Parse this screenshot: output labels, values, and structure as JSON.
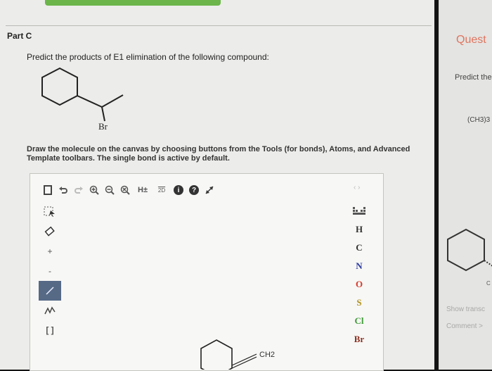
{
  "part": {
    "title": "Part C"
  },
  "question": {
    "text": "Predict the products of E1 elimination of the following compound:"
  },
  "compound": {
    "substituent_label": "Br"
  },
  "instructions": {
    "text": "Draw the molecule on the canvas by choosing buttons from the Tools (for bonds), Atoms, and Advanced Template toolbars. The single bond is active by default."
  },
  "editor": {
    "top_toolbar": [
      {
        "name": "new-document-icon",
        "glyph": "▢"
      },
      {
        "name": "undo-icon",
        "glyph": "↶"
      },
      {
        "name": "redo-icon",
        "glyph": "↷"
      },
      {
        "name": "zoom-in-icon",
        "glyph": "⊕"
      },
      {
        "name": "zoom-out-icon",
        "glyph": "⊖"
      },
      {
        "name": "reset-zoom-icon",
        "glyph": "⊗"
      },
      {
        "name": "explicit-hydrogens-button",
        "label": "H±"
      },
      {
        "name": "3d-view-button",
        "label": "2D"
      },
      {
        "name": "info-icon",
        "glyph": "i"
      },
      {
        "name": "help-icon",
        "glyph": "?"
      },
      {
        "name": "fullscreen-icon",
        "glyph": "⤢"
      }
    ],
    "atoms": [
      {
        "symbol": "H",
        "color": "#333333"
      },
      {
        "symbol": "C",
        "color": "#333333"
      },
      {
        "symbol": "N",
        "color": "#2c3aa0"
      },
      {
        "symbol": "O",
        "color": "#d83a2a"
      },
      {
        "symbol": "S",
        "color": "#b0921e"
      },
      {
        "symbol": "Cl",
        "color": "#3e9a36"
      },
      {
        "symbol": "Br",
        "color": "#8a3020"
      }
    ],
    "template_label": "CH2",
    "colors": {
      "active_tool": "#566a86",
      "green_bar": "#6bb54a"
    }
  },
  "side_panel": {
    "title": "Quest",
    "text": "Predict the",
    "formula": "(CH3)3",
    "ch_label": "C",
    "show_link": "Show transc",
    "comment_link": "Comment >"
  }
}
